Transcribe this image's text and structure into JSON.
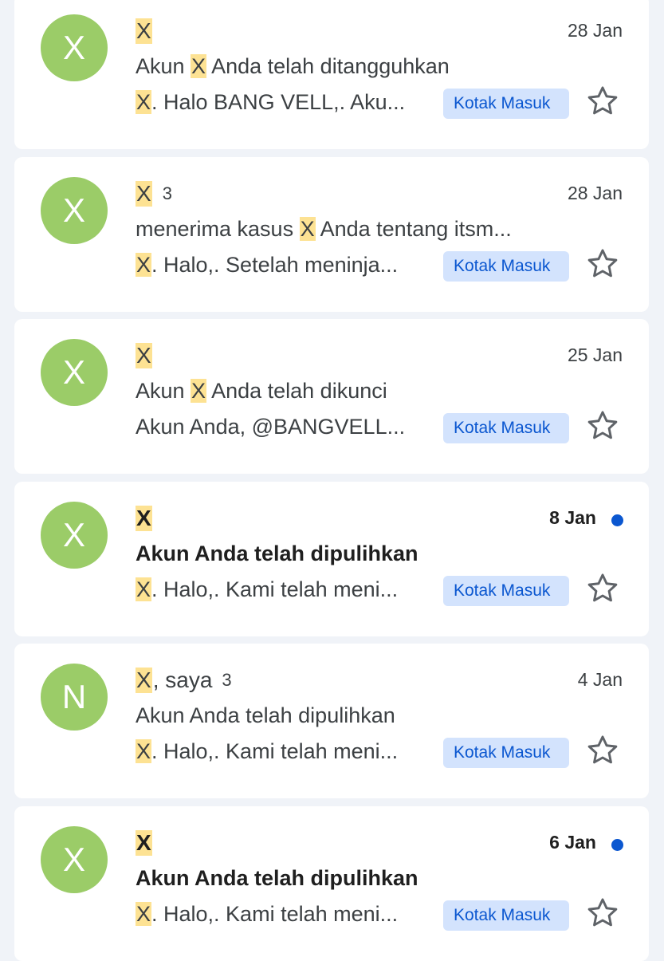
{
  "colors": {
    "background": "#f0f3f8",
    "card": "#ffffff",
    "avatar": "#9bcc68",
    "highlight": "#fde293",
    "label_chip_bg": "#d3e3fd",
    "label_chip_text": "#0b57d0",
    "unread_dot": "#0b57d0"
  },
  "emails": [
    {
      "avatar_letter": "X",
      "sender_highlight": "X",
      "sender_rest": "",
      "count": "",
      "date": "28 Jan",
      "unread": false,
      "subject_before": "Akun ",
      "subject_highlight": "X",
      "subject_after": " Anda telah ditangguhkan",
      "snippet_highlight": "X",
      "snippet_rest": ". Halo BANG VELL,. Aku...",
      "label": "Kotak Masuk",
      "star_icon": "star-outline-icon"
    },
    {
      "avatar_letter": "X",
      "sender_highlight": "X",
      "sender_rest": "",
      "count": "3",
      "date": "28 Jan",
      "unread": false,
      "subject_before": "menerima kasus ",
      "subject_highlight": "X",
      "subject_after": " Anda tentang itsm...",
      "snippet_highlight": "X",
      "snippet_rest": ". Halo,. Setelah meninja...",
      "label": "Kotak Masuk",
      "star_icon": "star-outline-icon"
    },
    {
      "avatar_letter": "X",
      "sender_highlight": "X",
      "sender_rest": "",
      "count": "",
      "date": "25 Jan",
      "unread": false,
      "subject_before": "Akun ",
      "subject_highlight": "X",
      "subject_after": " Anda telah dikunci",
      "snippet_highlight": "",
      "snippet_rest": "Akun Anda, @BANGVELL...",
      "label": "Kotak Masuk",
      "star_icon": "star-outline-icon"
    },
    {
      "avatar_letter": "X",
      "sender_highlight": "X",
      "sender_rest": "",
      "count": "",
      "date": "8 Jan",
      "unread": true,
      "subject_before": "Akun Anda telah dipulihkan",
      "subject_highlight": "",
      "subject_after": "",
      "snippet_highlight": "X",
      "snippet_rest": ". Halo,. Kami telah meni...",
      "label": "Kotak Masuk",
      "star_icon": "star-outline-icon"
    },
    {
      "avatar_letter": "N",
      "sender_highlight": "X",
      "sender_rest": ", saya",
      "count": "3",
      "date": "4 Jan",
      "unread": false,
      "subject_before": "Akun Anda telah dipulihkan",
      "subject_highlight": "",
      "subject_after": "",
      "snippet_highlight": "X",
      "snippet_rest": ". Halo,. Kami telah meni...",
      "label": "Kotak Masuk",
      "star_icon": "star-outline-icon"
    },
    {
      "avatar_letter": "X",
      "sender_highlight": "X",
      "sender_rest": "",
      "count": "",
      "date": "6 Jan",
      "unread": true,
      "subject_before": "Akun Anda telah dipulihkan",
      "subject_highlight": "",
      "subject_after": "",
      "snippet_highlight": "X",
      "snippet_rest": ". Halo,. Kami telah meni...",
      "label": "Kotak Masuk",
      "star_icon": "star-outline-icon"
    }
  ]
}
